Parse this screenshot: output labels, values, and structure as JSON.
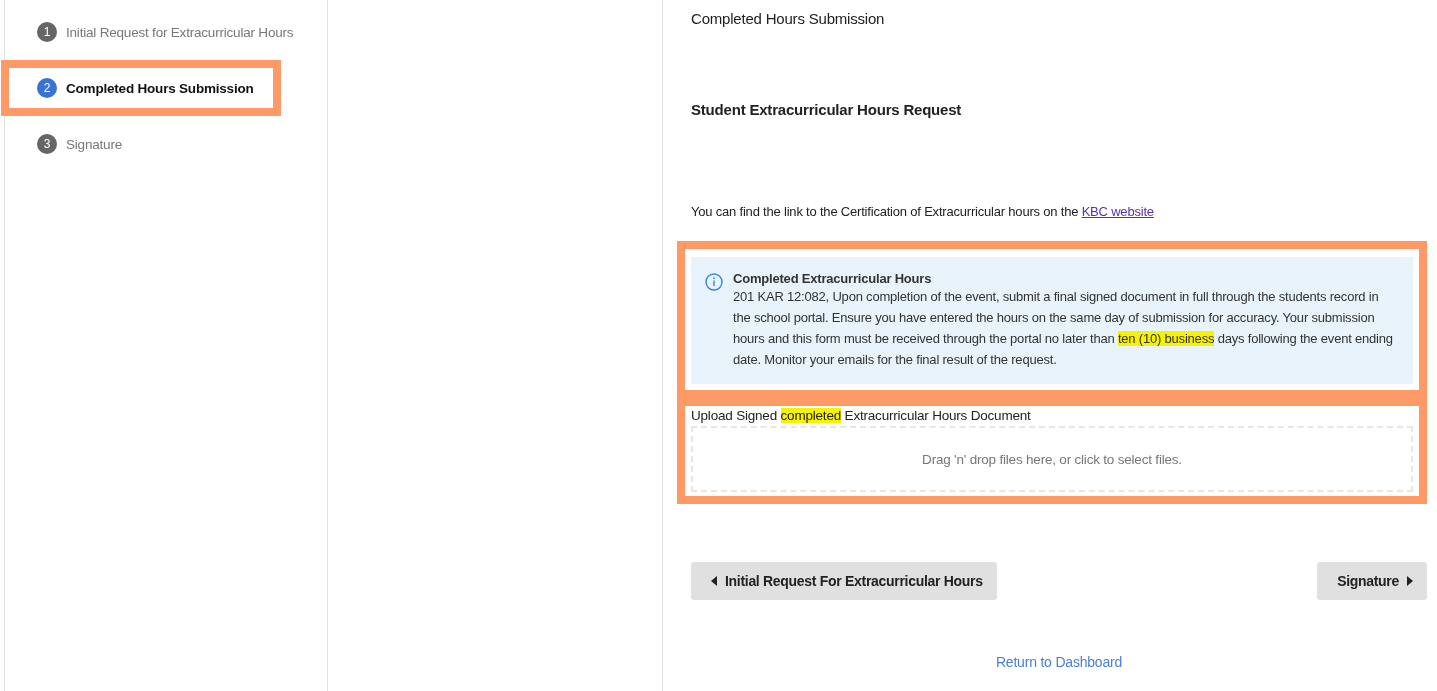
{
  "steps": [
    {
      "number": "1",
      "label": "Initial Request for Extracurricular Hours",
      "selected": false,
      "annotated": false
    },
    {
      "number": "2",
      "label": "Completed Hours Submission",
      "selected": true,
      "annotated": true
    },
    {
      "number": "3",
      "label": "Signature",
      "selected": false,
      "annotated": false
    }
  ],
  "page_heading": "Completed Hours Submission",
  "form_title": "Student Extracurricular Hours Request",
  "intro": {
    "text": "You can find the link to the Certification of Extracurricular hours on the ",
    "link": "KBC website"
  },
  "alert": {
    "annotated": true,
    "title": "Completed Extracurricular Hours",
    "body": [
      {
        "text": "201 KAR 12:082, Upon completion of the event, submit a final signed document in full through the students record in the school portal. Ensure you have entered the hours on the same day of submission for accuracy. Your submission hours and this form must be received through the portal no later than ",
        "highlighted": false
      },
      {
        "text": "ten (10) business",
        "highlighted": true
      },
      {
        "text": " days following the event ending date. Monitor your emails for the final result of the request.",
        "highlighted": false
      }
    ]
  },
  "upload": {
    "annotated": true,
    "label": [
      {
        "text": "Upload Signed ",
        "highlighted": false
      },
      {
        "text": "completed",
        "highlighted": true
      },
      {
        "text": " Extracurricular Hours Document",
        "highlighted": false
      }
    ],
    "placeholder": "Drag 'n' drop files here, or click to select files."
  },
  "buttons": {
    "previous": "Initial Request For Extracurricular Hours",
    "next": "Signature"
  },
  "return_link": "Return to Dashboard"
}
